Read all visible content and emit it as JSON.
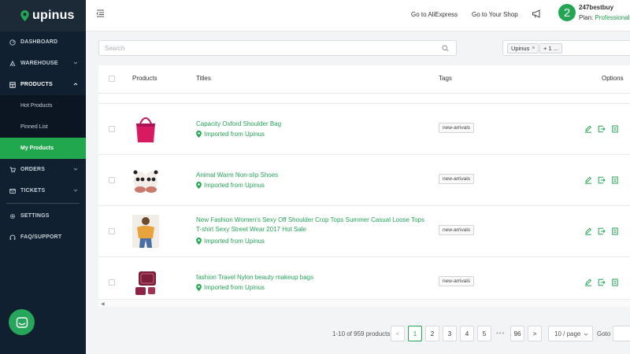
{
  "app": {
    "logo_text": "upinus",
    "brand_color": "#22a652"
  },
  "sidebar": {
    "items": [
      {
        "label": "DASHBOARD",
        "icon": "dashboard-icon"
      },
      {
        "label": "WAREHOUSE",
        "icon": "warehouse-icon"
      },
      {
        "label": "PRODUCTS",
        "icon": "products-icon"
      },
      {
        "label": "ORDERS",
        "icon": "orders-icon"
      },
      {
        "label": "TICKETS",
        "icon": "tickets-icon"
      },
      {
        "label": "SETTINGS",
        "icon": "gear-icon"
      },
      {
        "label": "FAQ/SUPPORT",
        "icon": "headset-icon"
      }
    ],
    "products_sub": [
      "Hot Products",
      "Pinned List",
      "My Products"
    ]
  },
  "header": {
    "link_aliexpress": "Go to AliExpress",
    "link_shop": "Go to Your Shop",
    "badge": "2",
    "user_name": "247bestbuy",
    "plan_label": "Plan:",
    "plan_value": "Professional"
  },
  "search": {
    "placeholder": "Search",
    "value": ""
  },
  "tag_filter": {
    "chips": [
      "Upinus",
      "+ 1 ..."
    ]
  },
  "table": {
    "columns": [
      "Products",
      "Titles",
      "Tags",
      "Options"
    ],
    "rows": [
      {
        "title": "Capacity Oxford Shoulder Bag",
        "source": "Imported from Upinus",
        "tag": "new-arrivals"
      },
      {
        "title": "Animal Warm Non-slip Shoes",
        "source": "Imported from Upinus",
        "tag": "new-arrivals"
      },
      {
        "title": "New Fashion Women's Sexy Off Shoulder Crop Tops Summer Casual Loose Tops T-shirt Sexy Street Wear 2017 Hot Sale",
        "source": "Imported from Upinus",
        "tag": "new-arrivals"
      },
      {
        "title": "fashion Travel Nylon beauty makeup bags",
        "source": "Imported from Upinus",
        "tag": "new-arrivals"
      }
    ]
  },
  "pagination": {
    "total_text": "1-10 of 959 products",
    "pages": [
      "1",
      "2",
      "3",
      "4",
      "5"
    ],
    "ellipsis": "•••",
    "last_page": "96",
    "prev": "<",
    "next": ">",
    "per_page": "10 / page",
    "goto_label": "Goto",
    "current_page": "1"
  }
}
